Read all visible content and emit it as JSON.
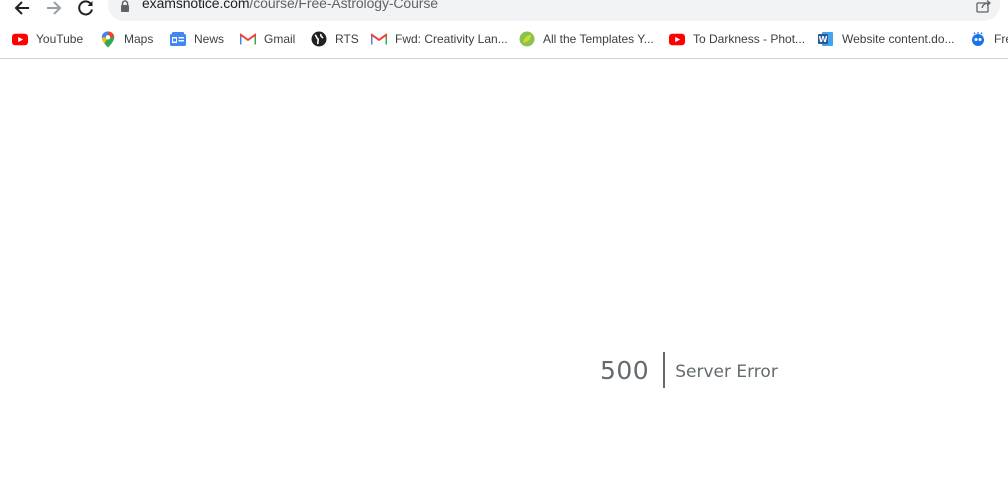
{
  "browser": {
    "url_host": "examsnotice.com",
    "url_path": "/course/Free-Astrology-Course",
    "bookmarks": [
      {
        "label": "YouTube",
        "icon": "youtube-icon"
      },
      {
        "label": "Maps",
        "icon": "maps-pin-icon"
      },
      {
        "label": "News",
        "icon": "google-news-icon"
      },
      {
        "label": "Gmail",
        "icon": "gmail-icon"
      },
      {
        "label": "RTS",
        "icon": "globe-icon"
      },
      {
        "label": "Fwd: Creativity Lan...",
        "icon": "gmail-icon"
      },
      {
        "label": "All the Templates Y...",
        "icon": "leaf-icon"
      },
      {
        "label": "To Darkness - Phot...",
        "icon": "youtube-icon"
      },
      {
        "label": "Website content.do...",
        "icon": "word-icon"
      },
      {
        "label": "Fre",
        "icon": "robot-icon"
      }
    ]
  },
  "page": {
    "error_code": "500",
    "error_message": "Server Error"
  },
  "colors": {
    "error_text": "#636b6f",
    "omnibox_bg": "#f1f3f4",
    "youtube_red": "#ff0000",
    "word_blue": "#2b579a"
  }
}
